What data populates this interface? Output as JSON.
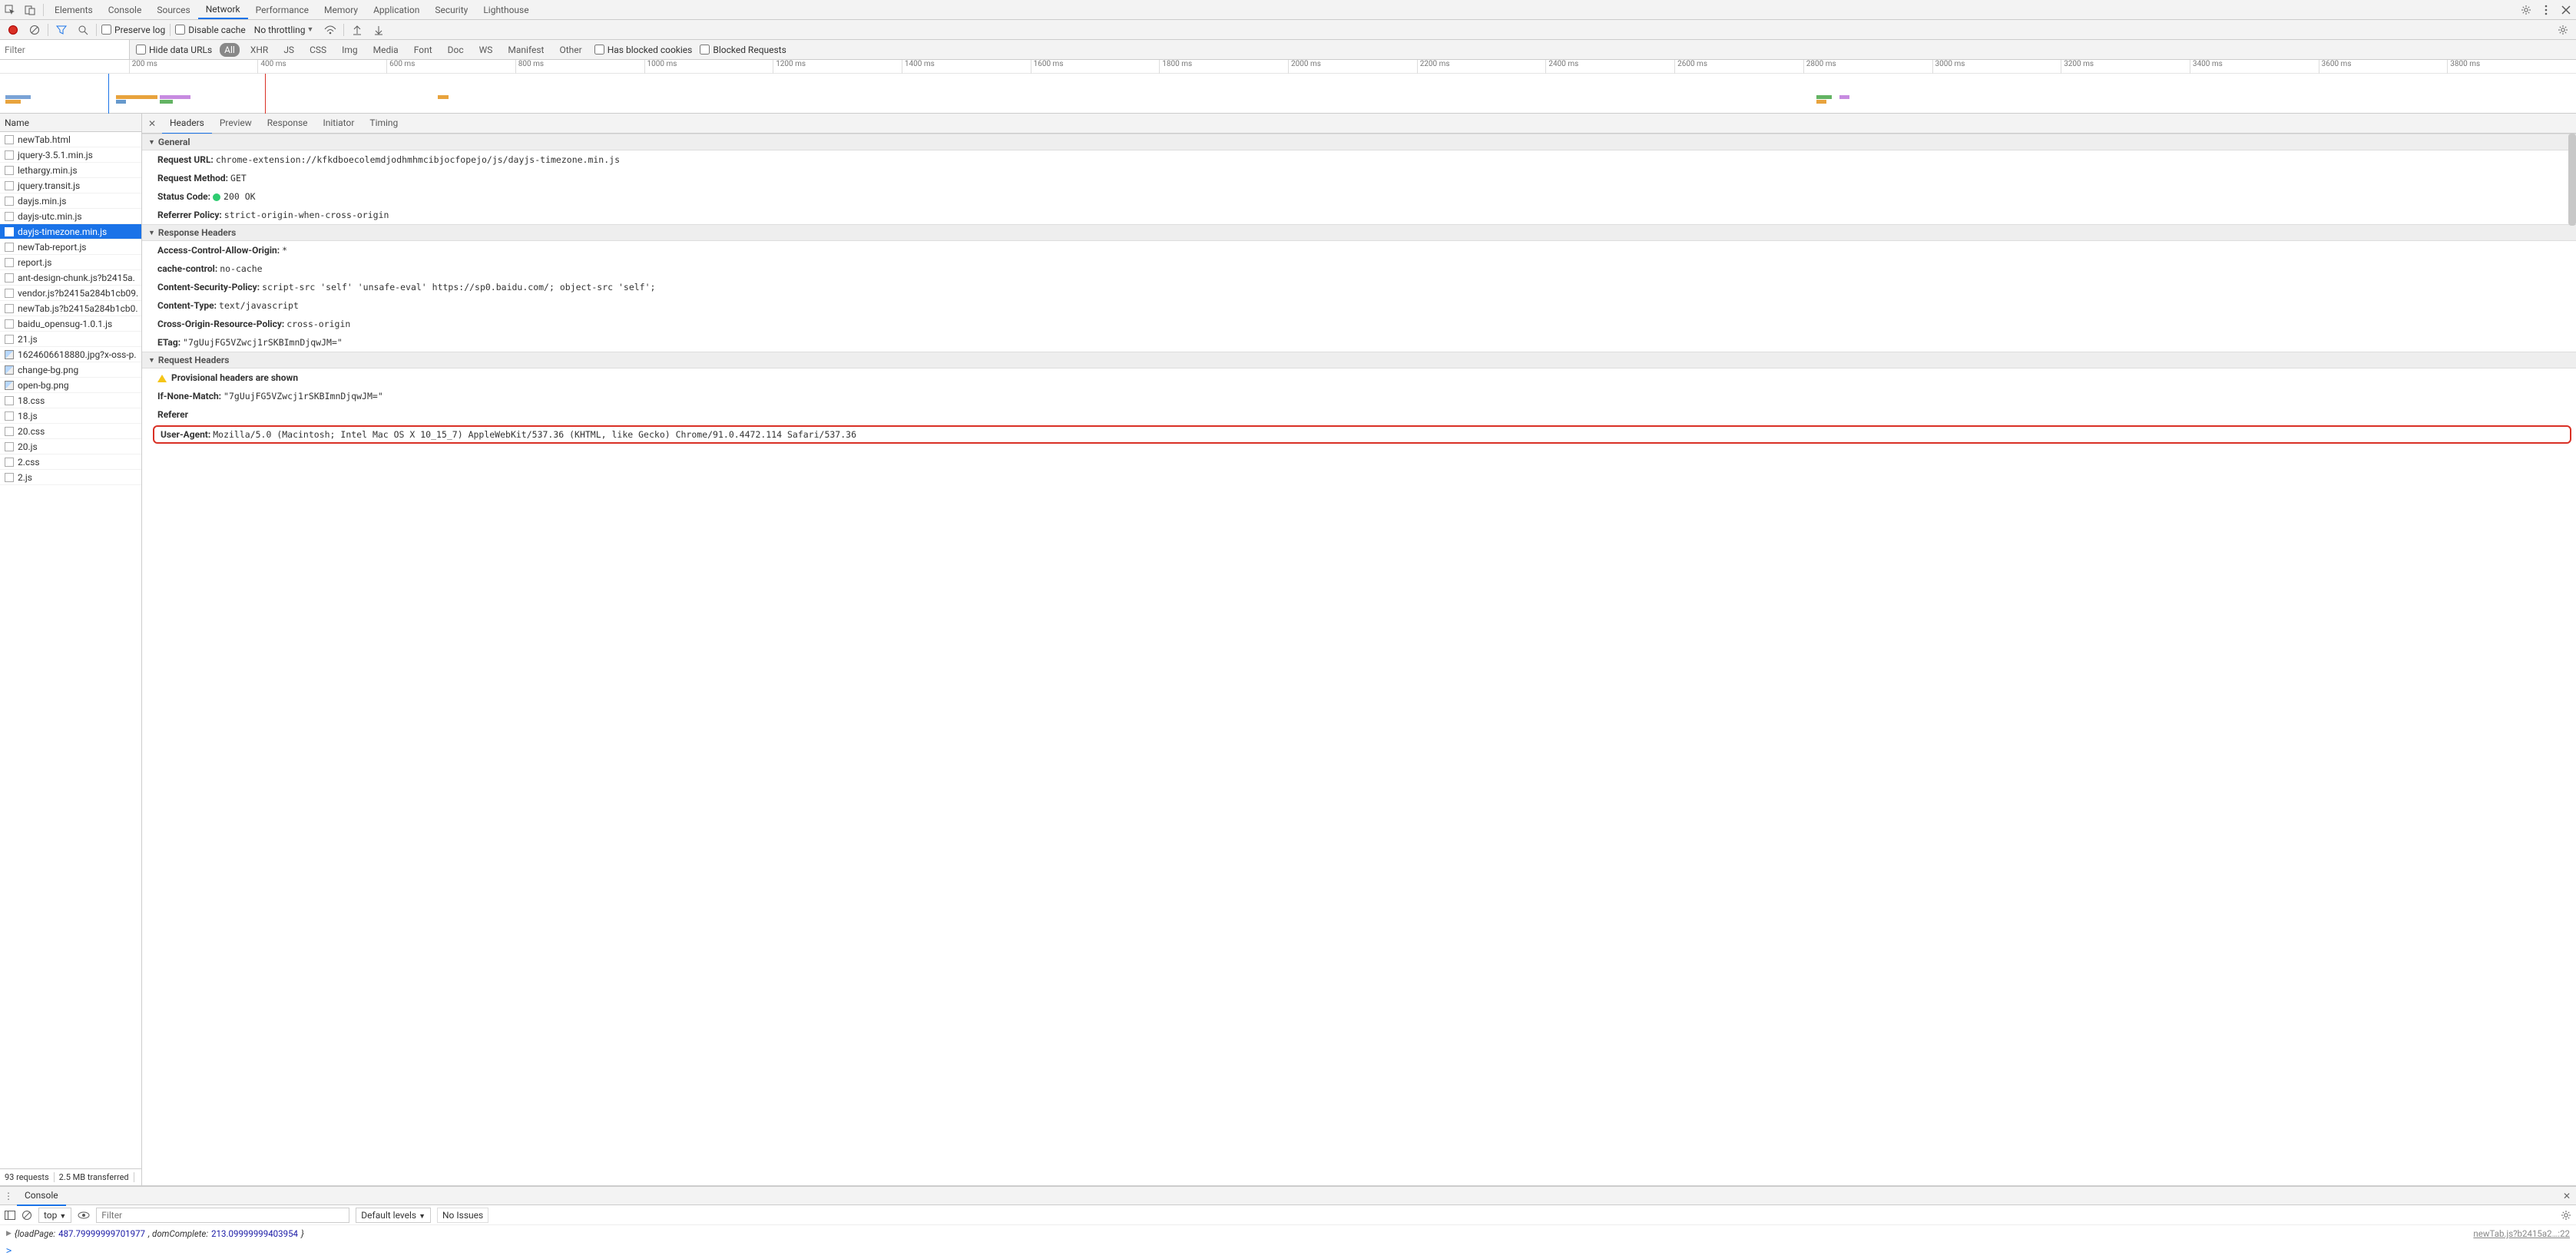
{
  "topTabs": [
    "Elements",
    "Console",
    "Sources",
    "Network",
    "Performance",
    "Memory",
    "Application",
    "Security",
    "Lighthouse"
  ],
  "activeTopTab": "Network",
  "toolbar": {
    "preserveLog": "Preserve log",
    "disableCache": "Disable cache",
    "throttling": "No throttling"
  },
  "filter": {
    "placeholder": "Filter",
    "hideDataUrls": "Hide data URLs",
    "types": [
      "All",
      "XHR",
      "JS",
      "CSS",
      "Img",
      "Media",
      "Font",
      "Doc",
      "WS",
      "Manifest",
      "Other"
    ],
    "hasBlocked": "Has blocked cookies",
    "blockedReq": "Blocked Requests"
  },
  "ruler": [
    "200 ms",
    "400 ms",
    "600 ms",
    "800 ms",
    "1000 ms",
    "1200 ms",
    "1400 ms",
    "1600 ms",
    "1800 ms",
    "2000 ms",
    "2200 ms",
    "2400 ms",
    "2600 ms",
    "2800 ms",
    "3000 ms",
    "3200 ms",
    "3400 ms",
    "3600 ms",
    "3800 ms"
  ],
  "nameHeader": "Name",
  "requests": [
    {
      "n": "newTab.html",
      "t": "doc"
    },
    {
      "n": "jquery-3.5.1.min.js",
      "t": "js"
    },
    {
      "n": "lethargy.min.js",
      "t": "js"
    },
    {
      "n": "jquery.transit.js",
      "t": "js"
    },
    {
      "n": "dayjs.min.js",
      "t": "js"
    },
    {
      "n": "dayjs-utc.min.js",
      "t": "js"
    },
    {
      "n": "dayjs-timezone.min.js",
      "t": "js",
      "sel": true
    },
    {
      "n": "newTab-report.js",
      "t": "js"
    },
    {
      "n": "report.js",
      "t": "js"
    },
    {
      "n": "ant-design-chunk.js?b2415a.",
      "t": "js"
    },
    {
      "n": "vendor.js?b2415a284b1cb09.",
      "t": "js"
    },
    {
      "n": "newTab.js?b2415a284b1cb0.",
      "t": "js"
    },
    {
      "n": "baidu_opensug-1.0.1.js",
      "t": "js"
    },
    {
      "n": "21.js",
      "t": "js"
    },
    {
      "n": "1624606618880.jpg?x-oss-p.",
      "t": "img"
    },
    {
      "n": "change-bg.png",
      "t": "img"
    },
    {
      "n": "open-bg.png",
      "t": "img"
    },
    {
      "n": "18.css",
      "t": "css"
    },
    {
      "n": "18.js",
      "t": "js"
    },
    {
      "n": "20.css",
      "t": "css"
    },
    {
      "n": "20.js",
      "t": "js"
    },
    {
      "n": "2.css",
      "t": "css"
    },
    {
      "n": "2.js",
      "t": "js"
    }
  ],
  "status": {
    "requests": "93 requests",
    "transferred": "2.5 MB transferred"
  },
  "detailTabs": [
    "Headers",
    "Preview",
    "Response",
    "Initiator",
    "Timing"
  ],
  "sections": {
    "general": "General",
    "response": "Response Headers",
    "request": "Request Headers"
  },
  "general": {
    "url_l": "Request URL:",
    "url_v": "chrome-extension://kfkdboecolemdjodhmhmcibjocfopejo/js/dayjs-timezone.min.js",
    "method_l": "Request Method:",
    "method_v": "GET",
    "status_l": "Status Code:",
    "status_v": "200 OK",
    "ref_l": "Referrer Policy:",
    "ref_v": "strict-origin-when-cross-origin"
  },
  "respH": {
    "acao_l": "Access-Control-Allow-Origin:",
    "acao_v": "*",
    "cc_l": "cache-control:",
    "cc_v": "no-cache",
    "csp_l": "Content-Security-Policy:",
    "csp_v": "script-src 'self' 'unsafe-eval' https://sp0.baidu.com/; object-src 'self';",
    "ct_l": "Content-Type:",
    "ct_v": "text/javascript",
    "corp_l": "Cross-Origin-Resource-Policy:",
    "corp_v": "cross-origin",
    "etag_l": "ETag:",
    "etag_v": "\"7gUujFG5VZwcj1rSKBImnDjqwJM=\""
  },
  "reqH": {
    "prov": "Provisional headers are shown",
    "inm_l": "If-None-Match:",
    "inm_v": "\"7gUujFG5VZwcj1rSKBImnDjqwJM=\"",
    "ref_l": "Referer",
    "ua_l": "User-Agent:",
    "ua_v": "Mozilla/5.0 (Macintosh; Intel Mac OS X 10_15_7) AppleWebKit/537.36 (KHTML, like Gecko) Chrome/91.0.4472.114 Safari/537.36"
  },
  "drawer": {
    "tab": "Console",
    "ctx": "top",
    "filterPh": "Filter",
    "levels": "Default levels",
    "noIssues": "No Issues",
    "log_pre": "{loadPage: ",
    "log_v1": "487.79999999701977",
    "log_mid": ", domComplete: ",
    "log_v2": "213.09999999403954",
    "log_suf": "}",
    "src": "newTab.js?b2415a2…:22",
    "prompt": ">"
  }
}
